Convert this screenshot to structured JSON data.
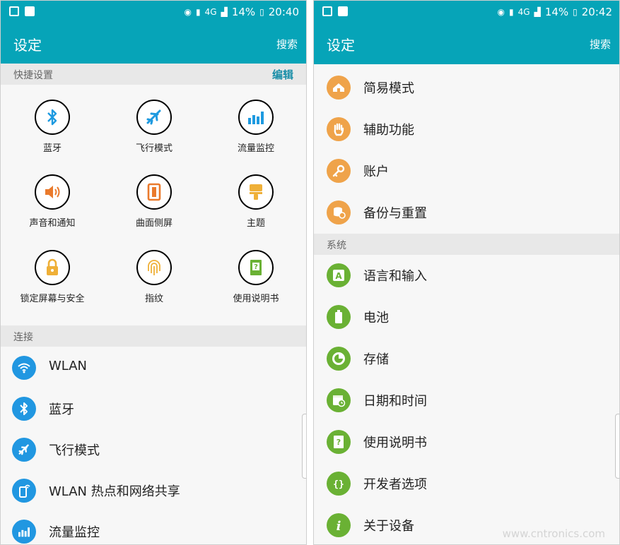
{
  "left": {
    "status": {
      "battery": "14%",
      "time": "20:40",
      "network": "4G"
    },
    "appbar": {
      "title": "设定",
      "search": "搜索"
    },
    "quick": {
      "header": "快捷设置",
      "edit": "编辑",
      "items": [
        {
          "label": "蓝牙",
          "icon": "bluetooth-icon"
        },
        {
          "label": "飞行模式",
          "icon": "airplane-icon"
        },
        {
          "label": "流量监控",
          "icon": "data-usage-icon"
        },
        {
          "label": "声音和通知",
          "icon": "speaker-icon"
        },
        {
          "label": "曲面侧屏",
          "icon": "edge-screen-icon"
        },
        {
          "label": "主题",
          "icon": "paintbrush-icon"
        },
        {
          "label": "锁定屏幕与安全",
          "icon": "lock-icon"
        },
        {
          "label": "指纹",
          "icon": "fingerprint-icon"
        },
        {
          "label": "使用说明书",
          "icon": "manual-icon"
        }
      ]
    },
    "connections": {
      "header": "连接",
      "items": [
        {
          "label": "WLAN",
          "icon": "wifi-icon"
        },
        {
          "label": "蓝牙",
          "icon": "bluetooth-icon"
        },
        {
          "label": "飞行模式",
          "icon": "airplane-icon"
        },
        {
          "label": "WLAN 热点和网络共享",
          "icon": "hotspot-icon"
        },
        {
          "label": "流量监控",
          "icon": "data-usage-icon"
        }
      ]
    }
  },
  "right": {
    "status": {
      "battery": "14%",
      "time": "20:42",
      "network": "4G"
    },
    "appbar": {
      "title": "设定",
      "search": "搜索"
    },
    "personal_items": [
      {
        "label": "简易模式",
        "icon": "easy-mode-icon"
      },
      {
        "label": "辅助功能",
        "icon": "hand-icon"
      },
      {
        "label": "账户",
        "icon": "key-icon"
      },
      {
        "label": "备份与重置",
        "icon": "backup-icon"
      }
    ],
    "system": {
      "header": "系统",
      "items": [
        {
          "label": "语言和输入",
          "icon": "language-icon"
        },
        {
          "label": "电池",
          "icon": "battery-icon"
        },
        {
          "label": "存储",
          "icon": "storage-icon"
        },
        {
          "label": "日期和时间",
          "icon": "calendar-icon"
        },
        {
          "label": "使用说明书",
          "icon": "manual-icon"
        },
        {
          "label": "开发者选项",
          "icon": "developer-icon"
        },
        {
          "label": "关于设备",
          "icon": "info-icon"
        }
      ]
    }
  },
  "watermark": "www.cntronics.com",
  "colors": {
    "teal": "#06a4b8",
    "blue": "#2197e1",
    "orange": "#efa34a",
    "green": "#6ab134",
    "edit_link": "#1a8ea8"
  }
}
